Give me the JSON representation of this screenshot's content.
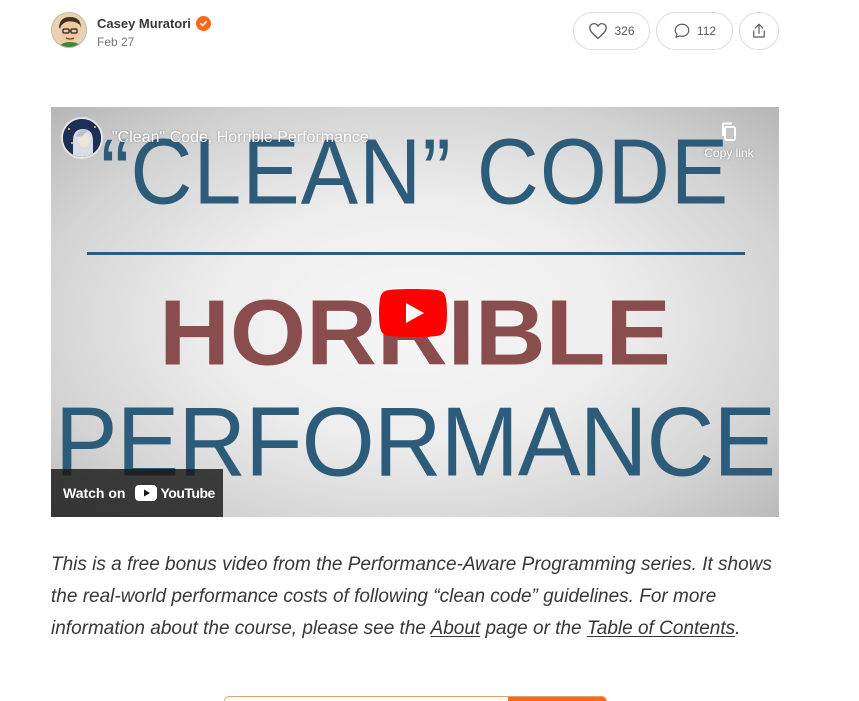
{
  "author": {
    "name": "Casey Muratori",
    "date": "Feb 27"
  },
  "actions": {
    "likes": "326",
    "comments": "112"
  },
  "video": {
    "title": "\"Clean\" Code, Horrible Performance",
    "copy_link_label": "Copy link",
    "watch_on_label": "Watch on",
    "youtube_label": "YouTube",
    "thumbnail": {
      "line1": "“CLEAN” CODE",
      "line2": "HORRIBLE",
      "line3": "PERFORMANCE"
    }
  },
  "body": {
    "text_before_about": "This is a free bonus video from the Performance-Aware Programming series. It shows the real-world performance costs of following “clean code” guidelines. For more information about the course, please see the ",
    "about_link": "About",
    "text_between": " page or the ",
    "toc_link": "Table of Contents",
    "text_after": "."
  },
  "colors": {
    "accent": "#ff6719",
    "thumb_blue": "#2d5b7a",
    "thumb_red": "#8a4d4d",
    "youtube_red": "#ff0000"
  }
}
